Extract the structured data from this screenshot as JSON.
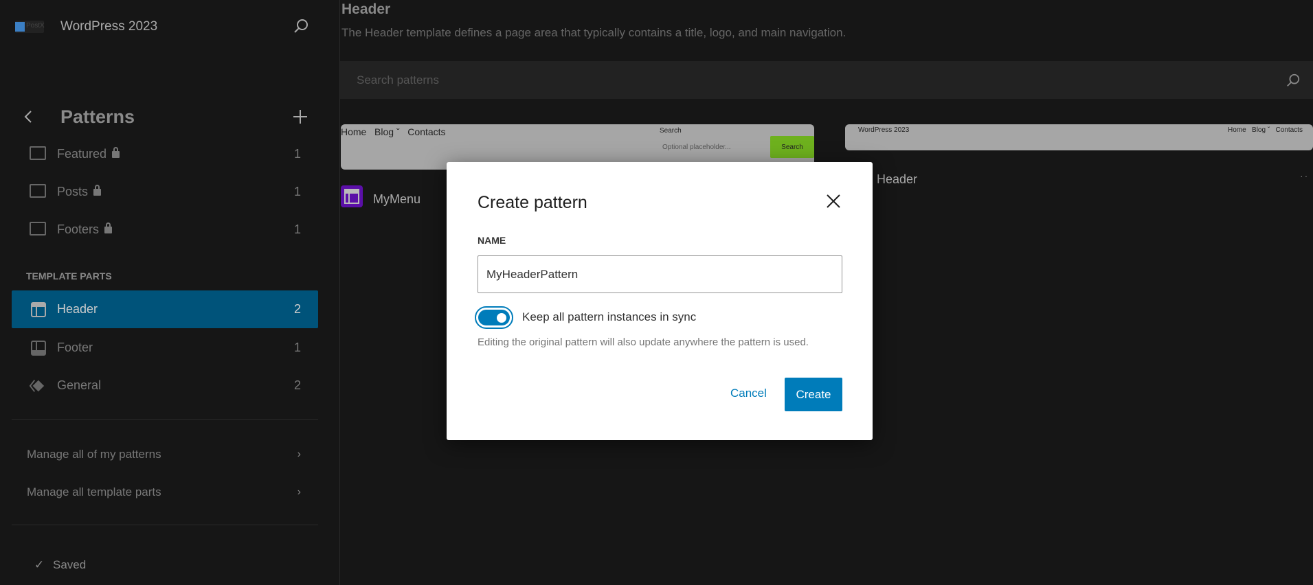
{
  "sidebar": {
    "logo_text": "PostX",
    "site_title": "WordPress 2023",
    "section_title": "Patterns",
    "categories": [
      {
        "label": "Featured",
        "count": "1",
        "locked": true
      },
      {
        "label": "Posts",
        "count": "1",
        "locked": true
      },
      {
        "label": "Footers",
        "count": "1",
        "locked": true
      }
    ],
    "template_parts_heading": "TEMPLATE PARTS",
    "template_parts": [
      {
        "label": "Header",
        "count": "2",
        "active": true
      },
      {
        "label": "Footer",
        "count": "1"
      },
      {
        "label": "General",
        "count": "2"
      }
    ],
    "manage_patterns": "Manage all of my patterns",
    "manage_template_parts": "Manage all template parts",
    "saved": "Saved"
  },
  "main": {
    "title": "Header",
    "description": "The Header template defines a page area that typically contains a title, logo, and main navigation.",
    "search_placeholder": "Search patterns",
    "cards": [
      {
        "name": "MyMenu",
        "preview": {
          "nav": [
            "Home",
            "Blog",
            "Contacts"
          ],
          "search_label": "Search",
          "search_placeholder": "Optional placeholder...",
          "search_button": "Search"
        }
      },
      {
        "name": "Header",
        "preview": {
          "site": "WordPress 2023",
          "nav": [
            "Home",
            "Blog",
            "Contacts"
          ]
        }
      }
    ]
  },
  "modal": {
    "title": "Create pattern",
    "name_label": "NAME",
    "name_value": "MyHeaderPattern",
    "sync_label": "Keep all pattern instances in sync",
    "sync_enabled": true,
    "help": "Editing the original pattern will also update anywhere the pattern is used.",
    "cancel": "Cancel",
    "create": "Create"
  },
  "colors": {
    "accent": "#007cba",
    "active_item": "#00537a",
    "background": "#161616",
    "card_icon": "#5b0fa8",
    "search_button": "#6eb11e"
  }
}
